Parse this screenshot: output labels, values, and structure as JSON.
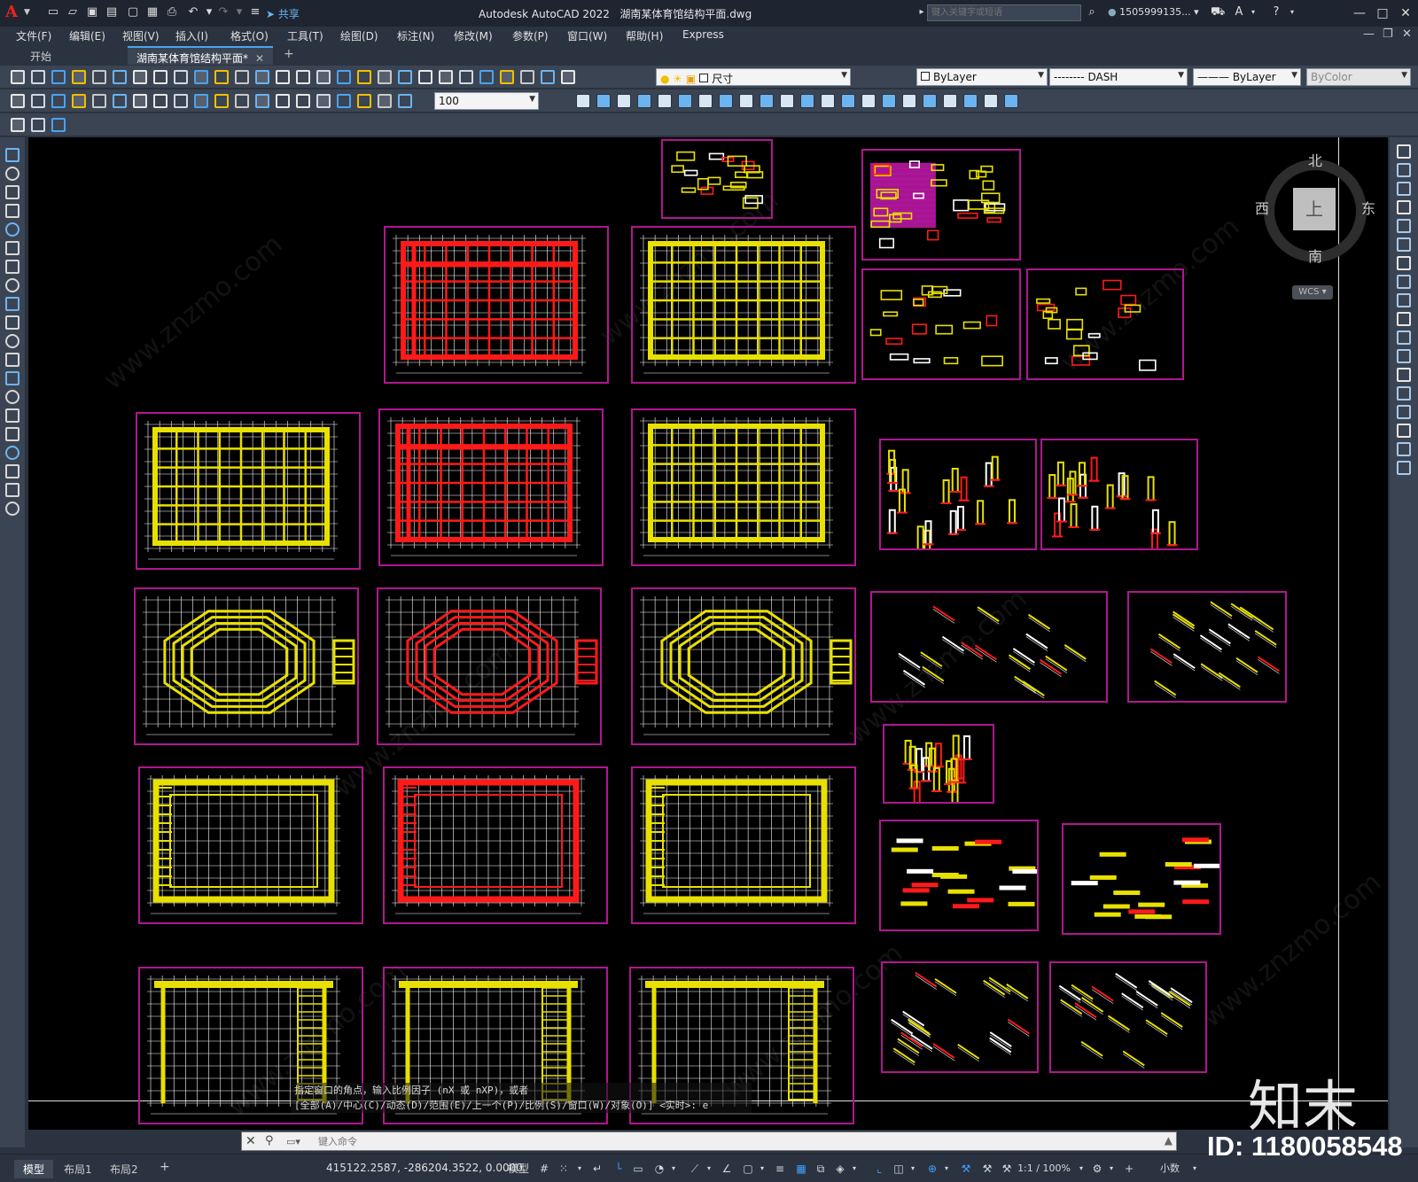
{
  "window": {
    "logo": "A",
    "share_label": "共享",
    "app_title": "Autodesk AutoCAD 2022",
    "file_title": "湖南某体育馆结构平面.dwg",
    "search_placeholder": "键入关键字或短语",
    "user_name": "1505999135...",
    "controls": [
      "—",
      "□",
      "✕"
    ]
  },
  "menu": [
    "文件(F)",
    "编辑(E)",
    "视图(V)",
    "插入(I)",
    "格式(O)",
    "工具(T)",
    "绘图(D)",
    "标注(N)",
    "修改(M)",
    "参数(P)",
    "窗口(W)",
    "帮助(H)",
    "Express"
  ],
  "file_tabs": [
    {
      "label": "开始",
      "active": false
    },
    {
      "label": "湖南某体育馆结构平面*",
      "active": true
    }
  ],
  "properties": {
    "layer": "尺寸",
    "color": "ByLayer",
    "linetype": "-------- DASH",
    "lineweight": "ByLayer",
    "plotstyle": "ByColor",
    "dim_scale": "100"
  },
  "viewcube": {
    "north": "北",
    "south": "南",
    "east": "东",
    "west": "西",
    "face": "上",
    "wcs": "WCS"
  },
  "command_history": [
    "指定窗口的角点，输入比例因子 (nX 或 nXP)，或者",
    "[全部(A)/中心(C)/动态(D)/范围(E)/上一个(P)/比例(S)/窗口(W)/对象(O)] <实时>:  e"
  ],
  "command_placeholder": "键入命令",
  "layout_tabs": [
    "模型",
    "布局1",
    "布局2"
  ],
  "status": {
    "coordinates": "415122.2587, -286204.3522, 0.0000",
    "space": "模型",
    "scale": "1:1 / 100%",
    "units": "小数"
  },
  "watermark": {
    "brand": "知末",
    "id": "ID: 1180058548"
  },
  "colors": {
    "sheet_border": "#b0178f",
    "structure_yellow": "#e8e000",
    "structure_red": "#ff1a1a",
    "grid_white": "#ffffff",
    "accent_blue": "#3fa0ff"
  }
}
